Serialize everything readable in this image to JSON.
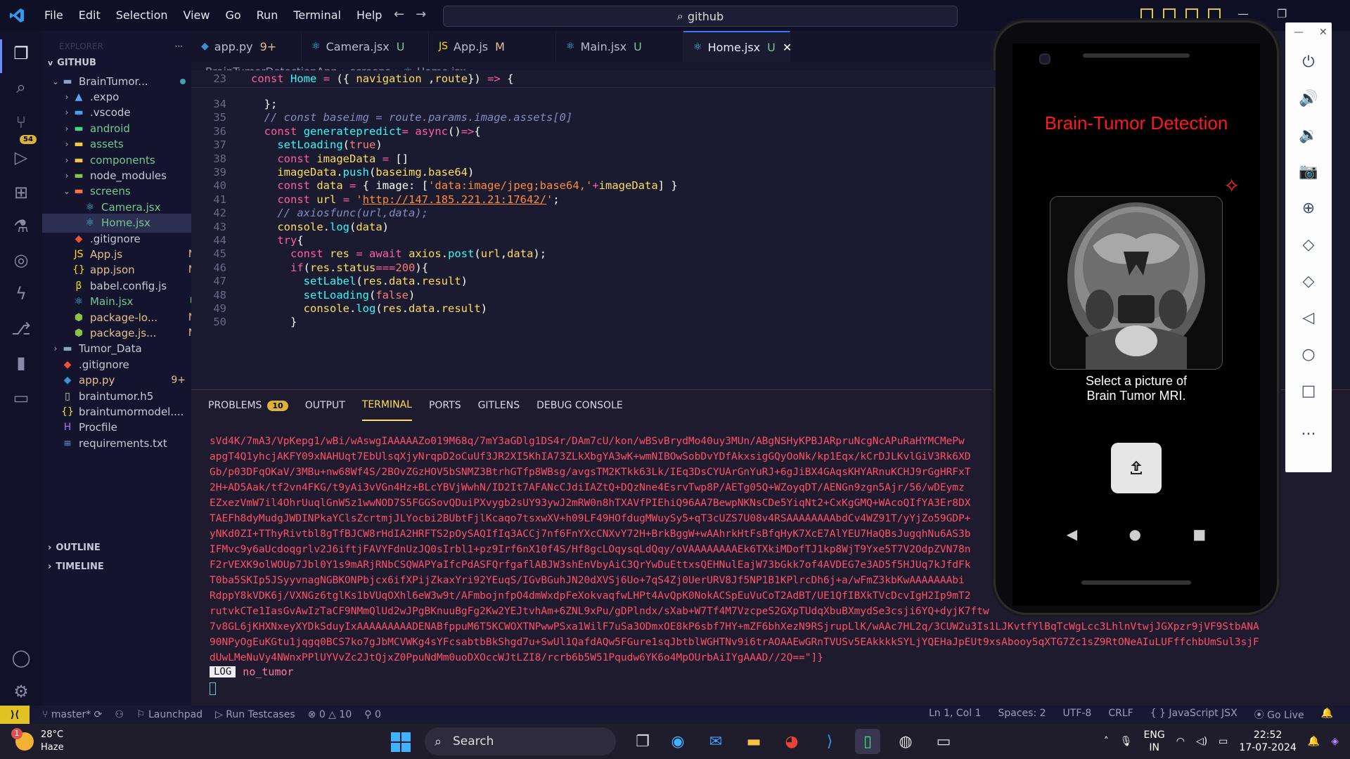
{
  "titlebar": {
    "menu": [
      "File",
      "Edit",
      "Selection",
      "View",
      "Go",
      "Run",
      "Terminal",
      "Help"
    ],
    "search": "github"
  },
  "activitybar": {
    "scm_badge": "54"
  },
  "sidebar": {
    "header": "EXPLORER",
    "root": "GITHUB",
    "items": [
      {
        "label": "BrainTumor...",
        "depth": 1,
        "chev": "v",
        "icon": "folder-icon",
        "decor": "dot"
      },
      {
        "label": ".expo",
        "depth": 2,
        "chev": ">",
        "icon": "expo-folder-icon",
        "decor": ""
      },
      {
        "label": ".vscode",
        "depth": 2,
        "chev": ">",
        "icon": "vscode-folder-icon",
        "decor": ""
      },
      {
        "label": "android",
        "depth": 2,
        "chev": ">",
        "icon": "android-folder-icon",
        "decor": "dot",
        "color": "#73c991"
      },
      {
        "label": "assets",
        "depth": 2,
        "chev": ">",
        "icon": "assets-folder-icon",
        "decor": "dot",
        "color": "#73c991"
      },
      {
        "label": "components",
        "depth": 2,
        "chev": ">",
        "icon": "components-folder-icon",
        "decor": "dot",
        "color": "#73c991"
      },
      {
        "label": "node_modules",
        "depth": 2,
        "chev": ">",
        "icon": "node-folder-icon",
        "decor": ""
      },
      {
        "label": "screens",
        "depth": 2,
        "chev": "v",
        "icon": "screens-folder-icon",
        "decor": "dot",
        "color": "#73c991"
      },
      {
        "label": "Camera.jsx",
        "depth": 3,
        "chev": "",
        "icon": "react-file-icon",
        "decor": "U",
        "color": "#73c991"
      },
      {
        "label": "Home.jsx",
        "depth": 3,
        "chev": "",
        "icon": "react-file-icon",
        "decor": "U",
        "color": "#73c991",
        "selected": true
      },
      {
        "label": ".gitignore",
        "depth": 2,
        "chev": "",
        "icon": "git-file-icon",
        "decor": ""
      },
      {
        "label": "App.js",
        "depth": 2,
        "chev": "",
        "icon": "js-file-icon",
        "decor": "M",
        "color": "#e2c08d"
      },
      {
        "label": "app.json",
        "depth": 2,
        "chev": "",
        "icon": "json-file-icon",
        "decor": "M",
        "color": "#e2c08d"
      },
      {
        "label": "babel.config.js",
        "depth": 2,
        "chev": "",
        "icon": "babel-file-icon",
        "decor": ""
      },
      {
        "label": "Main.jsx",
        "depth": 2,
        "chev": "",
        "icon": "react-file-icon",
        "decor": "U",
        "color": "#73c991"
      },
      {
        "label": "package-lo...",
        "depth": 2,
        "chev": "",
        "icon": "npm-file-icon",
        "decor": "M",
        "color": "#e2c08d"
      },
      {
        "label": "package.js...",
        "depth": 2,
        "chev": "",
        "icon": "npm-file-icon",
        "decor": "M",
        "color": "#e2c08d"
      },
      {
        "label": "Tumor_Data",
        "depth": 1,
        "chev": ">",
        "icon": "folder-icon",
        "decor": ""
      },
      {
        "label": ".gitignore",
        "depth": 1,
        "chev": "",
        "icon": "git-file-icon",
        "decor": ""
      },
      {
        "label": "app.py",
        "depth": 1,
        "chev": "",
        "icon": "python-file-icon",
        "decor": "9+",
        "color": "#e2c08d"
      },
      {
        "label": "braintumor.h5",
        "depth": 1,
        "chev": "",
        "icon": "file-icon",
        "decor": ""
      },
      {
        "label": "braintumormodel....",
        "depth": 1,
        "chev": "",
        "icon": "json-file-icon",
        "decor": ""
      },
      {
        "label": "Procfile",
        "depth": 1,
        "chev": "",
        "icon": "heroku-file-icon",
        "decor": ""
      },
      {
        "label": "requirements.txt",
        "depth": 1,
        "chev": "",
        "icon": "text-file-icon",
        "decor": ""
      }
    ],
    "outline": "OUTLINE",
    "timeline": "TIMELINE"
  },
  "tabs": [
    {
      "label": "app.py",
      "mod": "9+",
      "icon": "python-file-icon"
    },
    {
      "label": "Camera.jsx",
      "mod": "U",
      "icon": "react-file-icon"
    },
    {
      "label": "App.js",
      "mod": "M",
      "icon": "js-file-icon"
    },
    {
      "label": "Main.jsx",
      "mod": "U",
      "icon": "react-file-icon"
    },
    {
      "label": "Home.jsx",
      "mod": "U",
      "icon": "react-file-icon",
      "active": true
    }
  ],
  "breadcrumb": [
    "BrainTumorDetectionApp",
    "screens",
    "Home.jsx",
    "..."
  ],
  "code_lines": [
    {
      "n": "23",
      "html": "<span class='kw'>const</span> <span class='fn'>Home</span> <span class='kw'>=</span> <span class='plain'>({ </span><span class='var'>navigation</span> <span class='plain'>,</span><span class='var'>route</span><span class='plain'>}) </span><span class='kw'>=></span> <span class='plain'>{</span>"
    },
    {
      "n": "34",
      "html": "  <span class='plain'>};</span>"
    },
    {
      "n": "35",
      "html": "  <span class='cmt'>// const baseimg = route.params.image.assets[0]</span>"
    },
    {
      "n": "36",
      "html": "  <span class='kw'>const</span> <span class='fn'>generatepredict</span><span class='kw'>=</span> <span class='kw'>async</span><span class='plain'>()</span><span class='kw'>=></span><span class='plain'>{</span>"
    },
    {
      "n": "37",
      "html": "    <span class='fn'>setLoading</span><span class='plain'>(</span><span class='num'>true</span><span class='plain'>)</span>"
    },
    {
      "n": "38",
      "html": "    <span class='kw'>const</span> <span class='var'>imageData</span> <span class='kw'>=</span> <span class='plain'>[]</span>"
    },
    {
      "n": "39",
      "html": "    <span class='var'>imageData</span><span class='plain'>.</span><span class='fn'>push</span><span class='plain'>(</span><span class='var'>baseimg</span><span class='plain'>.</span><span class='var'>base64</span><span class='plain'>)</span>"
    },
    {
      "n": "40",
      "html": "    <span class='kw'>const</span> <span class='var'>data</span> <span class='kw'>=</span> <span class='plain'>{ image: [</span><span class='str'>'data:image/jpeg;base64,'</span><span class='kw'>+</span><span class='var'>imageData</span><span class='plain'>] }</span>"
    },
    {
      "n": "41",
      "html": "    <span class='kw'>const</span> <span class='var'>url</span> <span class='kw'>=</span> <span class='str'>'</span><span class='link'>http://147.185.221.21:17642/</span><span class='str'>'</span><span class='plain'>;</span>"
    },
    {
      "n": "42",
      "html": "    <span class='cmt'>// axiosfunc(url,data);</span>"
    },
    {
      "n": "43",
      "html": "    <span class='var'>console</span><span class='plain'>.</span><span class='fn'>log</span><span class='plain'>(</span><span class='var'>data</span><span class='plain'>)</span>"
    },
    {
      "n": "44",
      "html": "    <span class='kw'>try</span><span class='plain'>{</span>"
    },
    {
      "n": "45",
      "html": "      <span class='kw'>const</span> <span class='var'>res</span> <span class='kw'>=</span> <span class='kw'>await</span> <span class='var'>axios</span><span class='plain'>.</span><span class='fn'>post</span><span class='plain'>(</span><span class='var'>url</span><span class='plain'>,</span><span class='var'>data</span><span class='plain'>);</span>"
    },
    {
      "n": "46",
      "html": "      <span class='kw'>if</span><span class='plain'>(</span><span class='var'>res</span><span class='plain'>.</span><span class='var'>status</span><span class='kw'>===</span><span class='num'>200</span><span class='plain'>){</span>"
    },
    {
      "n": "47",
      "html": "        <span class='fn'>setLabel</span><span class='plain'>(</span><span class='var'>res</span><span class='plain'>.</span><span class='var'>data</span><span class='plain'>.</span><span class='var'>result</span><span class='plain'>)</span>"
    },
    {
      "n": "48",
      "html": "        <span class='fn'>setLoading</span><span class='plain'>(</span><span class='num'>false</span><span class='plain'>)</span>"
    },
    {
      "n": "49",
      "html": "        <span class='var'>console</span><span class='plain'>.</span><span class='fn'>log</span><span class='plain'>(</span><span class='var'>res</span><span class='plain'>.</span><span class='var'>data</span><span class='plain'>.</span><span class='var'>result</span><span class='plain'>)</span>"
    },
    {
      "n": "50",
      "html": "      <span class='plain'>}</span>"
    }
  ],
  "panel": {
    "tabs": [
      "PROBLEMS",
      "OUTPUT",
      "TERMINAL",
      "PORTS",
      "GITLENS",
      "DEBUG CONSOLE"
    ],
    "problems_count": "10",
    "active": "TERMINAL",
    "terminal_lines": [
      "sVd4K/7mA3/VpKepg1/wBi/wAswgIAAAAAZo019M68q/7mY3aGDlg1DS4r/DAm7cU/kon/wBSvBrydMo40uy3MUn/ABgNSHyKPBJARpruNcgNcAPuRaHYMCMePw",
      "apgT4Q1yhcjAKFY09xNAHUqt7EbUlsqXjyNrqpD2oCuUf3JR2XI5KhIA73ZLkXbgYA3wK+wmNIBOwSobDvYDfAkxsigGQyOoNk/kp1Eqx/kCrDJLKvlGiV3Rk6XD",
      "Gb/p03DFqOKaV/3MBu+nw68Wf4S/2BOvZGzHOV5bSNMZ3BtrhGTfp8WBsg/avgsTM2KTkk63Lk/IEq3DsCYUArGnYuRJ+6gJiBX4GAqsKHYARnuKCHJ9rGgHRFxT",
      "2H+AD5Aak/tf2vn4FKG/t9yAi3vVGn4Hz+BLcYBVjWwhN/ID2It7AFANcCJdiIAZtQ+DQzNne4EsrvTwp8P/AETg05Q+WZoyqDT/AENGn9zgn5Ajr/56/wDEymz",
      "EZxezVmW7il4OhrUuqlGnW5z1wwNOD7S5FGGSovQDuiPXvygb2sUY93ywJ2mRW0n8hTXAVfPIEhiQ96AA7BewpNKNsCDe5YiqNt2+CxKgGMQ+WAcoQIfYA3Er8DX",
      "TAEFh8dyMudgJWDINPkaYClsZcrtmjJLYocbi2BUbtFjlKcaqo7tsxwXV+h09LF49HOfdugMWuySy5+qT3cUZS7U08v4RSAAAAAAAAbdCv4WZ91T/yYjZo59GDP+",
      "yNKd0ZI+TThyRivtbl8gTfBJCW8rHdIA2HRFTS2pOySAQIfIq3ACCj7nf6FnYXcCNXvY72H+BrkBggW+wAAhrkHtFsBfqHyK7XcE7AlYEU7HaQBsJugqhNu6AS3b",
      "IFMvc9y6aUcdoqgrlv2J6iftjFAVYFdnUzJQ0sIrbl1+pz9Irf6nX10f4S/Hf8gcLOqysqLdQqy/oVAAAAAAAAEk6TXkiMDofTJ1kp8WjT9Yxe5T7V2OdpZVN78n",
      "F2rVEXK9olWOUp7Jbl0Y1s9mARjRNbCSQWAPYaIfcPdASFQrfgaflABJW3shEnVbyAiC3QrYwDuEttxsQEHNulEajW73bGkk7of4AVDEG7e3AD5f5HJUq7kJfdFk",
      "T0ba5SKIp5JSyyvnagNGBKONPbjcx6ifXPijZkaxYri92YEuqS/IGvBGuhJN20dXVSj6Uo+7qS4Zj0UerURV8Jf5NP1B1KPlrcDh6j+a/wFmZ3kbKwAAAAAAAbi",
      "RdppY8kVDK6j/VXNGz6tglKs1bVUqOXhl6eW3w9t/AFmbojnfpO4dmWxdpFeXokvaqfwLHPt4AvQpK0NokACSpEuVuCoT2AdBT/UE1QfIBXkTVcDcvIgH2Ip9mT2",
      "rutvkCTe1IasGvAwIzTaCF9NMmQlUd2wJPgBKnuuBgFg2Kw2YEJtvhAm+6ZNL9xPu/gDPlndx/sXab+W7Tf4M7VzcpeS2GXpTUdqXbuBXmydSe3csji6YQ+dyjK7ftw",
      "7v8GL6jKHXNxeyXYDkSduyIxAAAAAAAAADENABfppuM6T5KCWOXTNPwwPSxa1WilF7uSa3ODmxOE8kP6sbf7HY+mZF6bhXezN9RSjrupLlK/wAAc7HL2q/3CUW2u3Is1LJKvtfYlBqTcWgLcc3LhlnVtwjJGXpzr9jVF9StbANA",
      "90NPyOgEuKGtu1jqgq0BCS7ko7gJbMCVWKg4sYFcsabtbBkShgd7u+SwUl1QafdAQw5FGure1sqJbtblWGHTNv9i6trAOAAEwGRnTVUSv5EAkkkkSYLjYQEHaJpEUt9xsAbooy5qXTG7Zc1sZ9RtONeAIuLUFffchbUmSul3sjF",
      "dUwLMeNuVy4NWnxPPlUYVvZc2JtQjxZ0PpuNdMm0uoDXOccWJtLZI8/rcrb6b5W51Pqudw6YK6o4MpOUrbAiIYgAAAD//2Q==\"]}"
    ],
    "log_badge": "LOG",
    "log_text": "no_tumor"
  },
  "statusbar": {
    "branch": "master*",
    "launchpad": "Launchpad",
    "testcases": "Run Testcases",
    "errors": "0",
    "warnings": "10",
    "ports": "0",
    "position": "Ln 1, Col 1",
    "spaces": "Spaces: 2",
    "encoding": "UTF-8",
    "eol": "CRLF",
    "language": "JavaScript JSX",
    "golive": "Go Live"
  },
  "phone": {
    "title": "Brain-Tumor Detection",
    "select_text_line1": "Select a picture of",
    "select_text_line2": "Brain Tumor MRI."
  },
  "taskbar": {
    "temp": "28°C",
    "weather": "Haze",
    "weather_alert": "1",
    "search": "Search",
    "lang1": "ENG",
    "lang2": "IN",
    "time": "22:52",
    "date": "17-07-2024"
  }
}
